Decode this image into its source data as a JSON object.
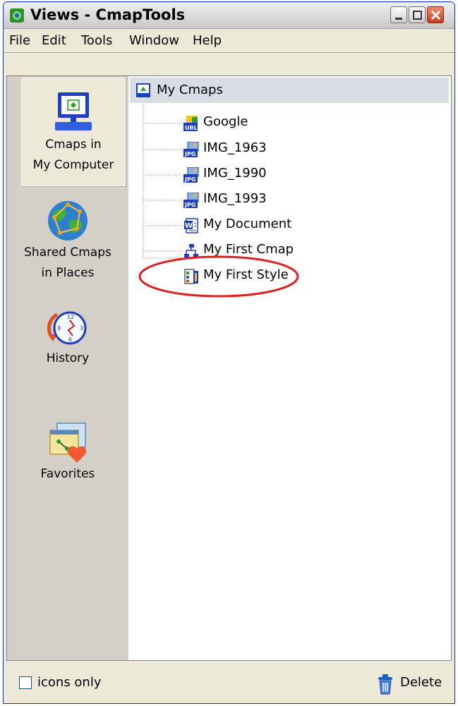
{
  "window": {
    "title": "Views - CmapTools"
  },
  "menu": {
    "items": [
      "File",
      "Edit",
      "Tools",
      "Window",
      "Help"
    ]
  },
  "places": {
    "items": [
      {
        "line1": "Cmaps in",
        "line2": "My Computer",
        "icon": "computer-icon",
        "selected": true
      },
      {
        "line1": "Shared Cmaps",
        "line2": "in Places",
        "icon": "globe-network-icon",
        "selected": false
      },
      {
        "line1": "History",
        "line2": "",
        "icon": "clock-icon",
        "selected": false
      },
      {
        "line1": "Favorites",
        "line2": "",
        "icon": "favorites-icon",
        "selected": false
      }
    ]
  },
  "tree": {
    "root": {
      "label": "My Cmaps",
      "icon": "folder-icon"
    },
    "items": [
      {
        "label": "Google",
        "icon": "url-icon"
      },
      {
        "label": "IMG_1963",
        "icon": "jpg-icon"
      },
      {
        "label": "IMG_1990",
        "icon": "jpg-icon"
      },
      {
        "label": "IMG_1993",
        "icon": "jpg-icon"
      },
      {
        "label": "My Document",
        "icon": "word-doc-icon"
      },
      {
        "label": "My First Cmap",
        "icon": "cmap-icon"
      },
      {
        "label": "My First Style",
        "icon": "style-icon",
        "highlighted": true
      }
    ]
  },
  "status": {
    "icons_only_label": "icons only",
    "icons_only_checked": false,
    "delete_label": "Delete"
  },
  "colors": {
    "highlight_circle": "#e02020",
    "title_bar": "#d8d8d8",
    "selected_place": "#ece9d8"
  }
}
